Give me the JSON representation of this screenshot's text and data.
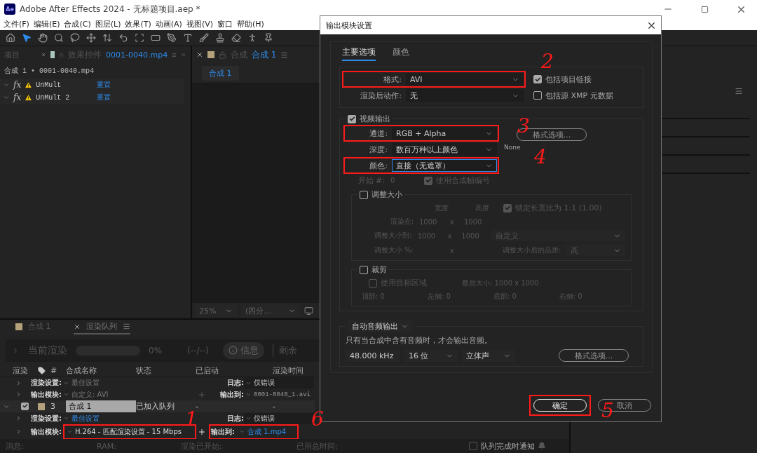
{
  "window": {
    "app_icon": "Ae",
    "title": "Adobe After Effects 2024 - 无标题项目.aep *"
  },
  "menu": [
    "文件(F)",
    "编辑(E)",
    "合成(C)",
    "图层(L)",
    "效果(T)",
    "动画(A)",
    "视图(V)",
    "窗口",
    "帮助(H)"
  ],
  "effect_controls": {
    "project_tab": "项目",
    "tab_label": "效果控件",
    "layer": "0001-0040.mp4",
    "breadcrumb": "合成 1 • 0001-0040.mp4",
    "effects": [
      {
        "badge": "fx",
        "name": "UnMult",
        "reset": "重置"
      },
      {
        "badge": "fx",
        "name": "UnMult 2",
        "reset": "重置"
      }
    ]
  },
  "composition": {
    "tab_label": "合成",
    "tab_name": "合成 1",
    "flow_chip": "合成 1",
    "zoom": "25%",
    "resolution": "(四分…"
  },
  "render_queue": {
    "tabs": [
      {
        "label": "合成 1",
        "selected": false
      },
      {
        "label": "渲染队列",
        "selected": true
      }
    ],
    "current_render": "当前渲染",
    "progress": "0%",
    "frames": "(--/--)",
    "info": "信息",
    "remaining": "剩余",
    "columns": [
      "渲染",
      "#",
      "合成名称",
      "状态",
      "已启动",
      "渲染时间"
    ],
    "previous_settings": {
      "render_label": "渲染设置:",
      "render_value": "最佳设置",
      "log_label": "日志:",
      "log_value": "仅错误",
      "module_label": "输出模块:",
      "module_value": "自定义: AVI",
      "output_label": "输出到:",
      "output_value": "0001-0040_1.avi"
    },
    "item": {
      "checked": true,
      "number": "3",
      "name": "合成 1",
      "status": "已加入队列",
      "started": "-",
      "render_time": "-"
    },
    "item_settings": {
      "render_label": "渲染设置:",
      "render_value": "最佳设置",
      "log_label": "日志:",
      "log_value": "仅错误",
      "module_label": "输出模块:",
      "module_value": "H.264 - 匹配渲染设置 - 15 Mbps",
      "module_highlighted": true,
      "output_label": "输出到:",
      "output_value": "合成 1.mp4",
      "output_highlighted": true
    },
    "status": [
      "消息:",
      "RAM:",
      "渲染已开始:",
      "已用总时间:"
    ],
    "notify": {
      "label": "队列完成时通知",
      "checked": false
    }
  },
  "dialog": {
    "title": "输出模块设置",
    "tabs": [
      {
        "label": "主要选项",
        "selected": true
      },
      {
        "label": "颜色",
        "selected": false
      }
    ],
    "format_fields": [
      {
        "label": "格式:",
        "value": "AVI",
        "highlighted": true
      },
      {
        "label": "渲染后动作:",
        "value": "无",
        "highlighted": false
      }
    ],
    "format_checks": [
      {
        "label": "包括项目链接",
        "checked": true
      },
      {
        "label": "包括源 XMP 元数据",
        "checked": false
      }
    ],
    "video": {
      "label": "视频输出",
      "checked": true,
      "fields": [
        {
          "label": "通道:",
          "value": "RGB + Alpha",
          "highlighted": true,
          "focused": false
        },
        {
          "label": "深度:",
          "value": "数百万种以上颜色",
          "highlighted": false,
          "focused": false
        },
        {
          "label": "颜色:",
          "value": "直接（无遮罩）",
          "highlighted": true,
          "focused": true
        }
      ],
      "format_options": "格式选项...",
      "format_note": "None",
      "start_label": "开始 #:",
      "start_value": "0",
      "use_comp_frame": {
        "label": "使用合成帧编号",
        "checked": true,
        "disabled": true
      }
    },
    "resize": {
      "label": "调整大小",
      "checked": false,
      "width_label": "宽度",
      "height_label": "高度",
      "lock": {
        "label": "锁定长宽比为 1:1 (1.00)",
        "checked": true
      },
      "render_at_label": "渲染在:",
      "render_w": "1000",
      "render_h": "1000",
      "render_x": "x",
      "resize_to_label": "调整大小到:",
      "resize_w": "1000",
      "resize_h": "1000",
      "resize_x": "x",
      "preset": "自定义",
      "percent_label": "调整大小 %:",
      "percent_x": "x",
      "quality_label": "调整大小后的品质:",
      "quality": "高"
    },
    "crop": {
      "label": "裁剪",
      "checked": false,
      "roi": {
        "label": "使用目标区域",
        "checked": false
      },
      "final_size": "最后大小: 1000 x 1000",
      "sides": [
        {
          "label": "顶部:",
          "value": "0"
        },
        {
          "label": "左侧:",
          "value": "0"
        },
        {
          "label": "底部:",
          "value": "0"
        },
        {
          "label": "右侧:",
          "value": "0"
        }
      ]
    },
    "audio": {
      "mode": "自动音频输出",
      "note": "只有当合成中含有音频时，才会输出音频。",
      "rate": "48.000 kHz",
      "bits": "16 位",
      "channels": "立体声",
      "format_options": "格式选项..."
    },
    "ok": {
      "label": "确定",
      "highlighted": true
    },
    "cancel": "取消"
  },
  "annotations": [
    {
      "label": "1"
    },
    {
      "label": "2"
    },
    {
      "label": "3"
    },
    {
      "label": "4"
    },
    {
      "label": "5"
    },
    {
      "label": "6"
    }
  ]
}
